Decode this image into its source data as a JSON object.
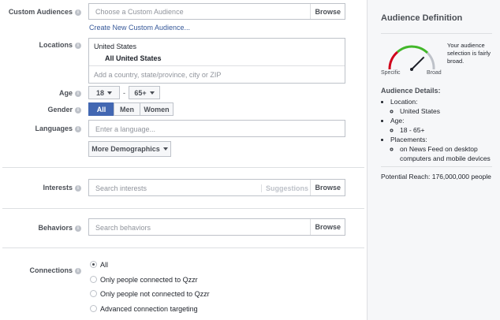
{
  "custom_audiences": {
    "label": "Custom Audiences",
    "placeholder": "Choose a Custom Audience",
    "browse": "Browse",
    "create_link": "Create New Custom Audience..."
  },
  "locations": {
    "label": "Locations",
    "country": "United States",
    "selected": "All United States",
    "placeholder": "Add a country, state/province, city or ZIP"
  },
  "age": {
    "label": "Age",
    "min": "18",
    "dash": "-",
    "max": "65+"
  },
  "gender": {
    "label": "Gender",
    "options": [
      "All",
      "Men",
      "Women"
    ],
    "selected": "All"
  },
  "languages": {
    "label": "Languages",
    "placeholder": "Enter a language..."
  },
  "more_demographics": "More Demographics",
  "interests": {
    "label": "Interests",
    "placeholder": "Search interests",
    "suggestions": "Suggestions",
    "browse": "Browse"
  },
  "behaviors": {
    "label": "Behaviors",
    "placeholder": "Search behaviors",
    "browse": "Browse"
  },
  "connections": {
    "label": "Connections",
    "options": [
      "All",
      "Only people connected to Qzzr",
      "Only people not connected to Qzzr",
      "Advanced connection targeting"
    ],
    "selected": 0
  },
  "audience_definition": {
    "title": "Audience Definition",
    "gauge_note": "Your audience selection is fairly broad.",
    "gauge_left": "Specific",
    "gauge_right": "Broad",
    "gauge_level": 0.75,
    "details_title": "Audience Details:",
    "details": [
      {
        "label": "Location:",
        "sub": "United States"
      },
      {
        "label": "Age:",
        "sub": "18 - 65+"
      },
      {
        "label": "Placements:",
        "sub": "on News Feed on desktop computers and mobile devices"
      }
    ],
    "potential_reach": "Potential Reach: 176,000,000 people"
  },
  "colors": {
    "accent": "#4267b2",
    "link": "#365899",
    "gauge_red": "#d0021b",
    "gauge_green": "#42b72a"
  }
}
